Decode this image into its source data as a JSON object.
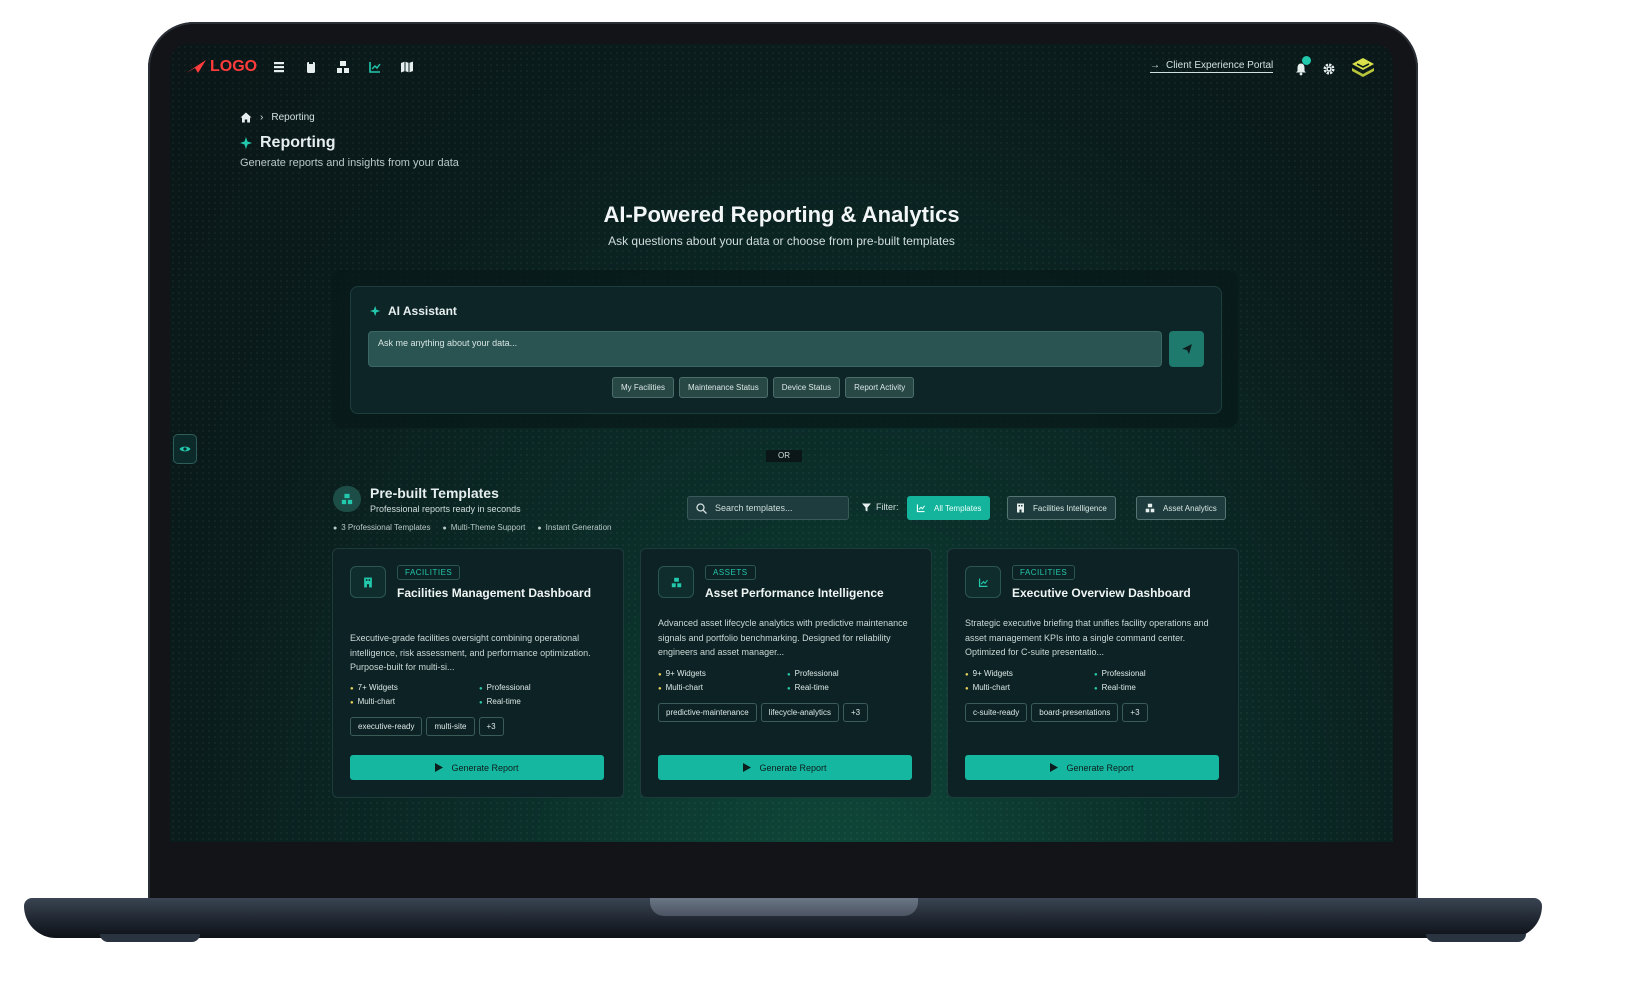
{
  "nav": {
    "logo_text": "LOGO",
    "icons": [
      "list-icon",
      "clipboard-icon",
      "asset-icon",
      "chart-icon",
      "map-icon"
    ],
    "portal_link": "Client Experience Portal"
  },
  "breadcrumb": {
    "current": "Reporting"
  },
  "page": {
    "title": "Reporting",
    "subtitle": "Generate reports and insights from your data"
  },
  "hero": {
    "title": "AI-Powered Reporting & Analytics",
    "subtitle": "Ask questions about your data or choose from pre-built templates"
  },
  "assistant": {
    "label": "AI Assistant",
    "placeholder": "Ask me anything about your data...",
    "chips": [
      "My Facilities",
      "Maintenance Status",
      "Device Status",
      "Report Activity"
    ]
  },
  "divider_text": "OR",
  "templates": {
    "title": "Pre-built Templates",
    "subtitle": "Professional reports ready in seconds",
    "meta": [
      "3 Professional Templates",
      "Multi-Theme Support",
      "Instant Generation"
    ],
    "search_placeholder": "Search templates...",
    "filter_label": "Filter:",
    "filters": [
      "All Templates",
      "Facilities Intelligence",
      "Asset Analytics"
    ],
    "active_filter": "All Templates",
    "generate_label": "Generate Report",
    "cards": [
      {
        "category": "FACILITIES",
        "title": "Facilities Management Dashboard",
        "description": "Executive-grade facilities oversight combining operational intelligence, risk assessment, and performance optimization. Purpose-built for multi-si...",
        "features": [
          "7+ Widgets",
          "Professional",
          "Multi-chart",
          "Real-time"
        ],
        "tags": [
          "executive-ready",
          "multi-site",
          "+3"
        ]
      },
      {
        "category": "ASSETS",
        "title": "Asset Performance Intelligence",
        "description": "Advanced asset lifecycle analytics with predictive maintenance signals and portfolio benchmarking. Designed for reliability engineers and asset manager...",
        "features": [
          "9+ Widgets",
          "Professional",
          "Multi-chart",
          "Real-time"
        ],
        "tags": [
          "predictive-maintenance",
          "lifecycle-analytics",
          "+3"
        ]
      },
      {
        "category": "FACILITIES",
        "title": "Executive Overview Dashboard",
        "description": "Strategic executive briefing that unifies facility operations and asset management KPIs into a single command center. Optimized for C-suite presentatio...",
        "features": [
          "9+ Widgets",
          "Professional",
          "Multi-chart",
          "Real-time"
        ],
        "tags": [
          "c-suite-ready",
          "board-presentations",
          "+3"
        ]
      }
    ]
  },
  "colors": {
    "accent": "#14b39c",
    "logo": "#ff3b3b",
    "notification": "#22c9ad"
  }
}
